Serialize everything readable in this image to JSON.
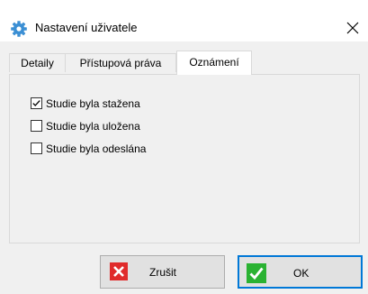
{
  "window": {
    "title": "Nastavení uživatele",
    "close_icon": "close-icon",
    "app_icon": "gear-icon"
  },
  "tabs": [
    {
      "label": "Detaily",
      "active": false
    },
    {
      "label": "Přístupová práva",
      "active": false
    },
    {
      "label": "Oznámení",
      "active": true
    }
  ],
  "notifications": [
    {
      "label": "Studie byla stažena",
      "checked": true
    },
    {
      "label": "Studie byla uložena",
      "checked": false
    },
    {
      "label": "Studie byla odeslána",
      "checked": false
    }
  ],
  "buttons": {
    "cancel": {
      "label": "Zrušit",
      "icon": "cancel-x-icon",
      "color": "#e02b2b"
    },
    "ok": {
      "label": "OK",
      "icon": "checkmark-icon",
      "color": "#2ab232"
    }
  },
  "colors": {
    "accent": "#0078d7",
    "window_bg": "#f0f0f0",
    "titlebar_bg": "#ffffff"
  }
}
